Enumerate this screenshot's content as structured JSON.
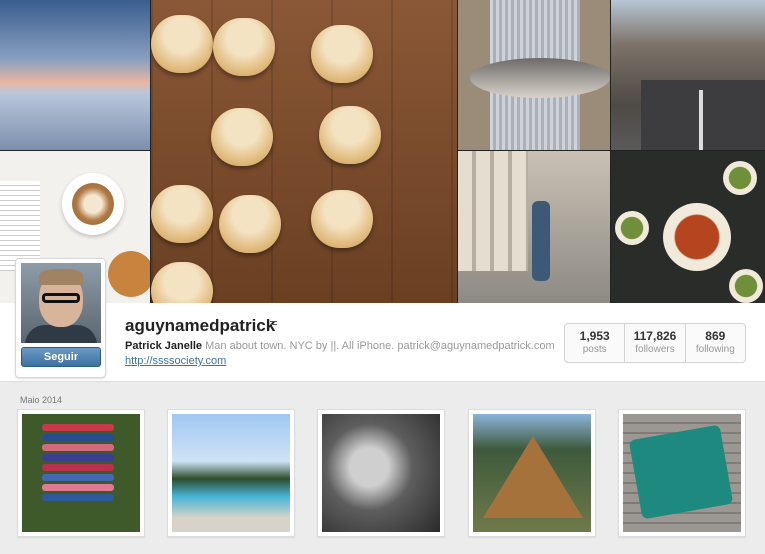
{
  "profile": {
    "username": "aguynamedpatrick",
    "full_name": "Patrick Janelle",
    "bio": "Man about town. NYC by ||. All iPhone. patrick@aguynamedpatrick.com",
    "website": "http://ssssociety.com",
    "follow_label": "Seguir"
  },
  "stats": [
    {
      "value": "1,953",
      "label": "posts"
    },
    {
      "value": "117,826",
      "label": "followers"
    },
    {
      "value": "869",
      "label": "following"
    }
  ],
  "feed": {
    "month_label": "Maio 2014",
    "photos": [
      {
        "name": "yoga-mats-photo"
      },
      {
        "name": "pool-photo"
      },
      {
        "name": "bw-skewers-photo"
      },
      {
        "name": "tent-photo"
      },
      {
        "name": "lunch-tray-photo"
      }
    ]
  },
  "colors": {
    "link": "#3f729b",
    "follow_button": "#3d71a0",
    "background": "#ececec"
  }
}
